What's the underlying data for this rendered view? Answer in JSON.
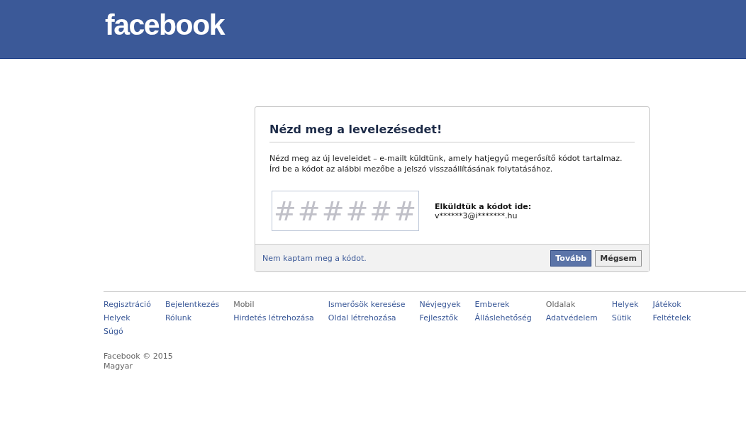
{
  "header": {
    "logo": "facebook"
  },
  "dialog": {
    "title": "Nézd meg a levelezésedet!",
    "description": "Nézd meg az új leveleidet – e-mailt küldtünk, amely hatjegyű megerősítő kódot tartalmaz. Írd be a kódot az alábbi mezőbe a jelszó visszaállításának folytatásához.",
    "code_field": {
      "placeholder": "######"
    },
    "sent_to_label": "Elküldtük a kódot ide:",
    "sent_to_address": "v******3@i*******.hu",
    "resend_link": "Nem kaptam meg a kódot.",
    "buttons": [
      {
        "label": "Tovább",
        "kind": "primary"
      },
      {
        "label": "Mégsem",
        "kind": "secondary"
      }
    ]
  },
  "footer": {
    "columns": [
      [
        {
          "label": "Regisztráció",
          "kind": "link"
        },
        {
          "label": "Helyek",
          "kind": "link"
        },
        {
          "label": "Súgó",
          "kind": "link"
        }
      ],
      [
        {
          "label": "Bejelentkezés",
          "kind": "link"
        },
        {
          "label": "Rólunk",
          "kind": "link"
        }
      ],
      [
        {
          "label": "Mobil",
          "kind": "text"
        },
        {
          "label": "Hirdetés létrehozása",
          "kind": "link"
        }
      ],
      [
        {
          "label": "Ismerősök keresése",
          "kind": "link"
        },
        {
          "label": "Oldal létrehozása",
          "kind": "link"
        }
      ],
      [
        {
          "label": "Névjegyek",
          "kind": "link"
        },
        {
          "label": "Fejlesztők",
          "kind": "link"
        }
      ],
      [
        {
          "label": "Emberek",
          "kind": "link"
        },
        {
          "label": "Álláslehetőség",
          "kind": "link"
        }
      ],
      [
        {
          "label": "Oldalak",
          "kind": "text"
        },
        {
          "label": "Adatvédelem",
          "kind": "link"
        }
      ],
      [
        {
          "label": "Helyek",
          "kind": "link"
        },
        {
          "label": "Sütik",
          "kind": "link"
        }
      ],
      [
        {
          "label": "Játékok",
          "kind": "link"
        },
        {
          "label": "Feltételek",
          "kind": "link"
        }
      ]
    ],
    "copyright": "Facebook © 2015",
    "language": "Magyar"
  }
}
